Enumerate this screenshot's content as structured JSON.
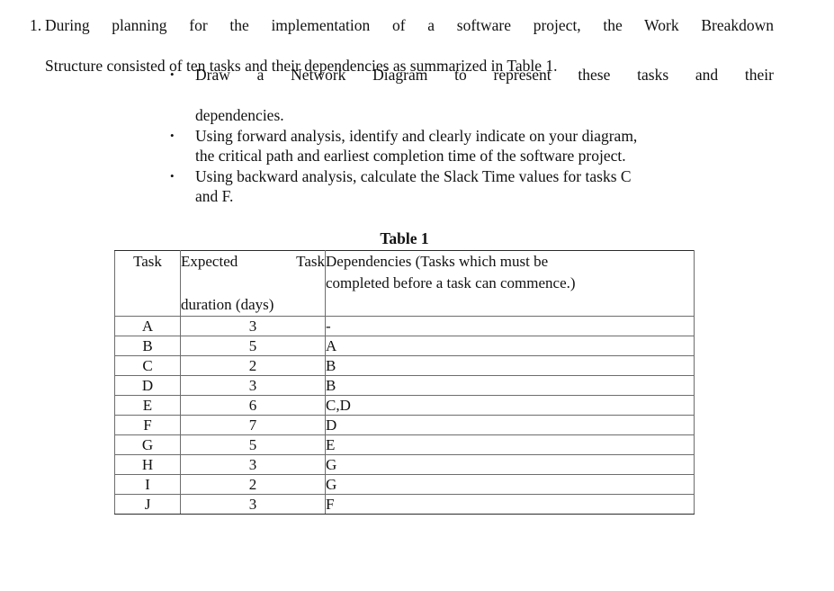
{
  "document": {
    "question": {
      "number": "1.",
      "line1": "During planning for the implementation of a software project, the Work Breakdown",
      "line2": "Structure consisted of ten tasks and their dependencies as summarized in Table 1."
    },
    "bullet_marker": "•",
    "bullets": [
      {
        "line1": "Draw a Network Diagram to represent these tasks and their",
        "line2": "dependencies.",
        "justified": true
      },
      {
        "line1": "Using forward analysis, identify and clearly indicate on your diagram,",
        "line2": "the critical path and earliest completion time of the software project.",
        "justified": false
      },
      {
        "line1": "Using backward analysis, calculate the Slack Time values for tasks C",
        "line2": "and F.",
        "justified": false
      }
    ],
    "table": {
      "caption": "Table 1",
      "headers": {
        "task": "Task",
        "duration_line1": "Expected Task",
        "duration_line2": "duration (days)",
        "dependencies_line1": "Dependencies (Tasks which must be",
        "dependencies_line2": "completed before a task can commence.)"
      },
      "rows": [
        {
          "task": "A",
          "duration": "3",
          "dependencies": "-"
        },
        {
          "task": "B",
          "duration": "5",
          "dependencies": "A"
        },
        {
          "task": "C",
          "duration": "2",
          "dependencies": "B"
        },
        {
          "task": "D",
          "duration": "3",
          "dependencies": "B"
        },
        {
          "task": "E",
          "duration": "6",
          "dependencies": "C,D"
        },
        {
          "task": "F",
          "duration": "7",
          "dependencies": "D"
        },
        {
          "task": "G",
          "duration": "5",
          "dependencies": "E"
        },
        {
          "task": "H",
          "duration": "3",
          "dependencies": "G"
        },
        {
          "task": "I",
          "duration": "2",
          "dependencies": "G"
        },
        {
          "task": "J",
          "duration": "3",
          "dependencies": "F"
        }
      ]
    }
  },
  "colors": {
    "page_background": "#ffffff",
    "text": "#111111",
    "table_border": "#6d6d6d",
    "table_outer_border": "#2a2a2a"
  }
}
